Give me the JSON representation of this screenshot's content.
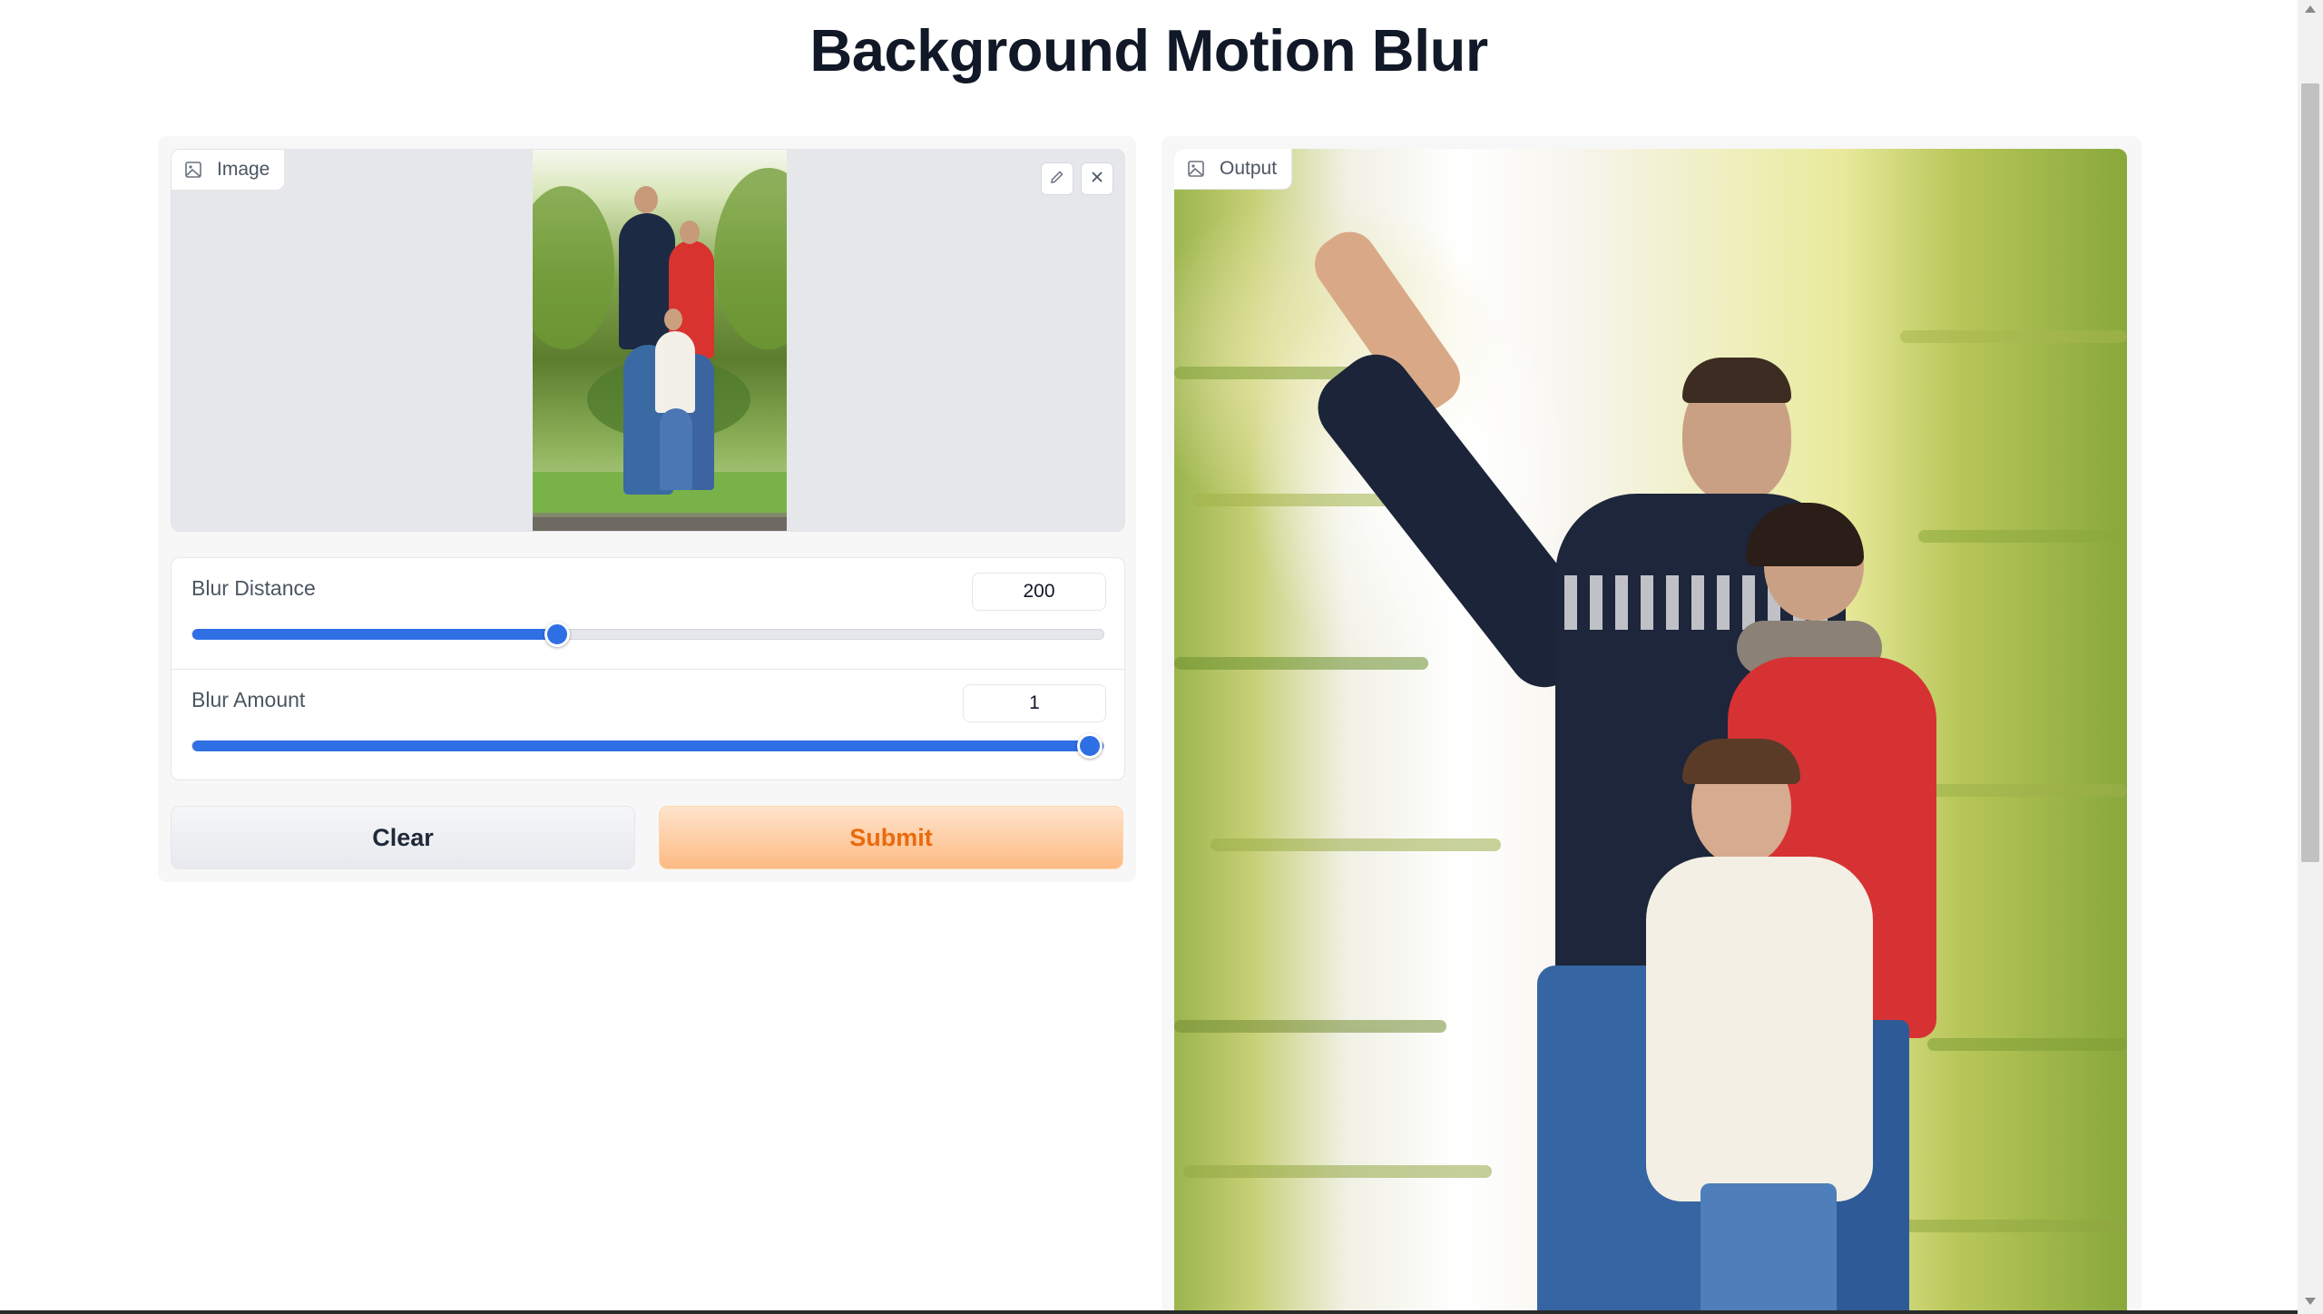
{
  "page": {
    "title": "Background Motion Blur"
  },
  "input": {
    "label": "Image",
    "label_icon": "image-icon",
    "edit_icon": "pencil-icon",
    "close_icon": "close-icon"
  },
  "controls": {
    "blur_distance": {
      "label": "Blur Distance",
      "value": "200",
      "level": 0.4
    },
    "blur_amount": {
      "label": "Blur Amount",
      "value": "1",
      "level": 1.0
    }
  },
  "buttons": {
    "clear": "Clear",
    "submit": "Submit"
  },
  "output": {
    "label": "Output",
    "label_icon": "image-icon"
  },
  "colors": {
    "accent": "#2f6fe4",
    "submit_text": "#ea6a0d",
    "submit_bg": "#fdba83"
  }
}
